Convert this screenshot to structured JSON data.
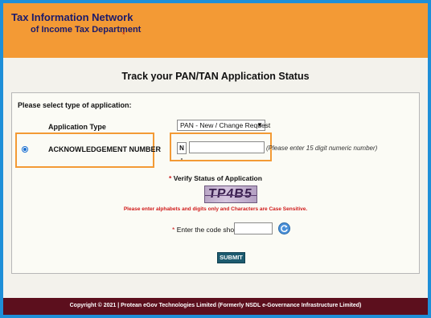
{
  "header": {
    "brand_line1": "Tax Information Network",
    "brand_line2": "of Income Tax Department",
    "brand_mark": "*",
    "background_color": "#f39a35",
    "text_color": "#1b1b6b"
  },
  "page_title": "Track your PAN/TAN Application Status",
  "form": {
    "select_type_label": "Please select type of application:",
    "application_type_label": "Application Type",
    "application_type_value": "PAN - New / Change Request",
    "acknowledgement_label": "ACKNOWLEDGEMENT NUMBER",
    "acknowledgement_selected": true,
    "acknowledgement_prefix": "N -",
    "acknowledgement_value": "",
    "acknowledgement_hint": "(Please enter 15 digit numeric number)",
    "verify_heading": "Verify Status of Application",
    "required_mark": "*",
    "captcha_text": "TP4B5",
    "captcha_warning": "Please enter alphabets and digits only and Characters are Case Sensitive.",
    "code_label": "Enter the code shown:",
    "code_value": "",
    "refresh_icon": "refresh-icon",
    "submit_label": "SUBMIT"
  },
  "highlight_color": "#f39a35",
  "footer": {
    "text": "Copyright © 2021 | Protean eGov Technologies Limited (Formerly NSDL e-Governance Infrastructure Limited)",
    "background_color": "#5c0f1d"
  },
  "frame_color": "#1e8fd8"
}
